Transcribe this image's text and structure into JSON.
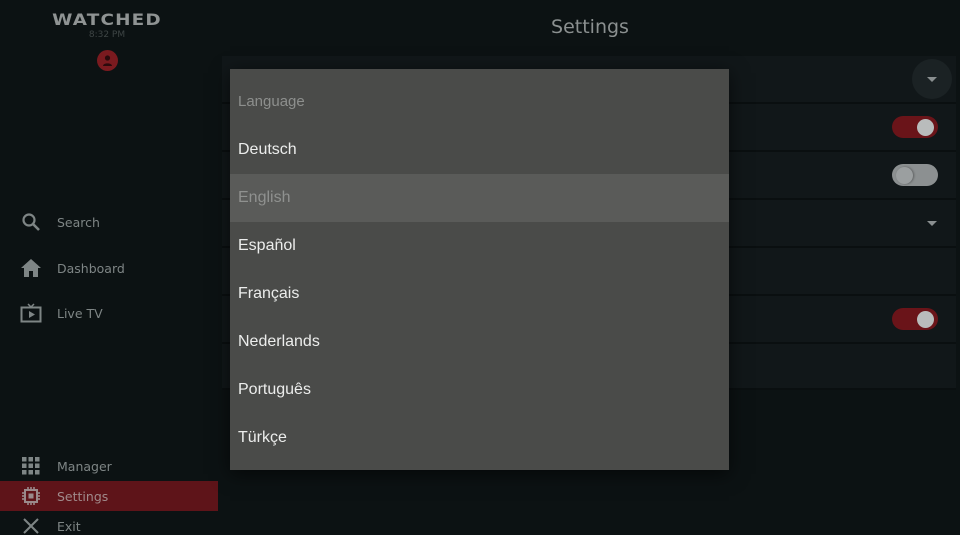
{
  "app": {
    "logo": "WATCHED",
    "clock": "8:32 PM",
    "accent_color": "#7a1a1f"
  },
  "sidebar": {
    "items": [
      {
        "id": "search",
        "label": "Search",
        "icon": "search-icon"
      },
      {
        "id": "dashboard",
        "label": "Dashboard",
        "icon": "home-icon"
      },
      {
        "id": "live-tv",
        "label": "Live TV",
        "icon": "tv-icon"
      },
      {
        "id": "manager",
        "label": "Manager",
        "icon": "grid-icon"
      },
      {
        "id": "settings",
        "label": "Settings",
        "icon": "chip-icon",
        "active": true
      },
      {
        "id": "exit",
        "label": "Exit",
        "icon": "close-icon"
      }
    ]
  },
  "main": {
    "title": "Settings",
    "rows": [
      {
        "control": "dropdown"
      },
      {
        "control": "toggle",
        "on": true
      },
      {
        "control": "toggle",
        "on": false
      },
      {
        "control": "dropdown"
      },
      {
        "control": "none"
      },
      {
        "control": "toggle",
        "on": true
      },
      {
        "control": "none"
      }
    ]
  },
  "language_dialog": {
    "title": "Language",
    "selected": "English",
    "options": [
      "Deutsch",
      "English",
      "Español",
      "Français",
      "Nederlands",
      "Português",
      "Türkçe"
    ]
  }
}
